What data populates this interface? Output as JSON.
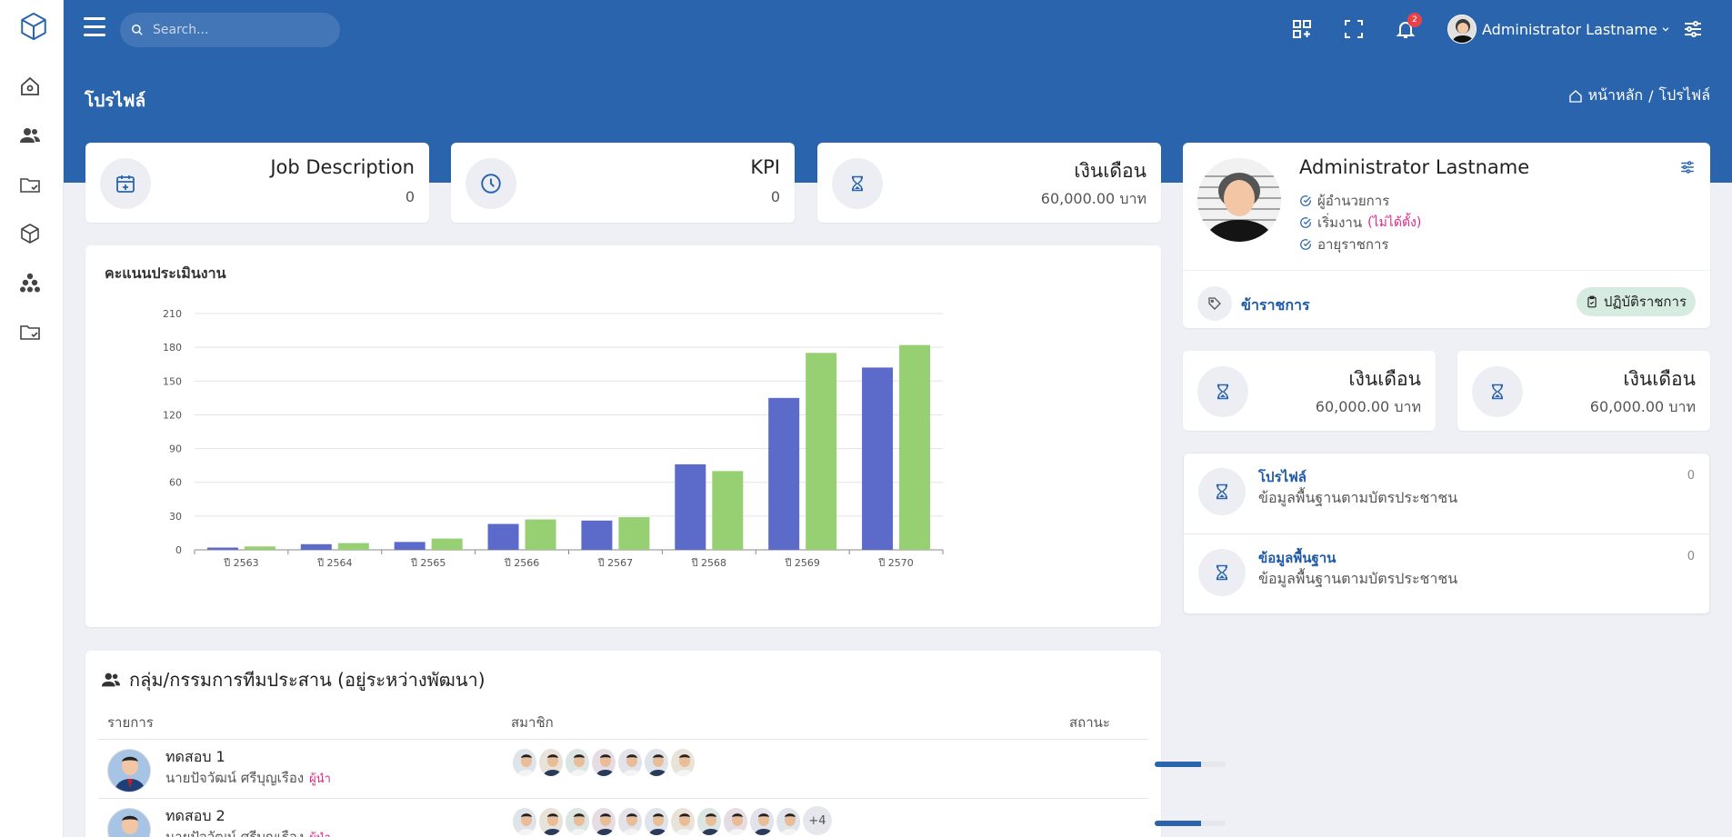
{
  "search": {
    "placeholder": "Search..."
  },
  "header": {
    "user_name": "Administrator Lastname",
    "notification_count": "2"
  },
  "page": {
    "title": "โปรไฟล์"
  },
  "breadcrumb": {
    "home": "หน้าหลัก",
    "separator": "/",
    "current": "โปรไฟล์"
  },
  "stats": [
    {
      "title": "Job Description",
      "value": "0",
      "icon": "calendar-plus-icon"
    },
    {
      "title": "KPI",
      "value": "0",
      "icon": "clock-icon"
    },
    {
      "title": "เงินเดือน",
      "value": "60,000.00 บาท",
      "icon": "hourglass-icon"
    }
  ],
  "chart_card": {
    "title": "คะแนนประเมินงาน"
  },
  "chart_data": {
    "type": "bar",
    "categories": [
      "ปี 2563",
      "ปี 2564",
      "ปี 2565",
      "ปี 2566",
      "ปี 2567",
      "ปี 2568",
      "ปี 2569",
      "ปี 2570"
    ],
    "series": [
      {
        "values": [
          2,
          5,
          7,
          23,
          26,
          76,
          135,
          162
        ],
        "color": "#5c6bc9"
      },
      {
        "values": [
          3,
          6,
          10,
          27,
          29,
          70,
          175,
          182
        ],
        "color": "#97d073"
      }
    ],
    "yticks": [
      "0",
      "30",
      "60",
      "90",
      "120",
      "150",
      "180",
      "210"
    ],
    "ylim": [
      0,
      210
    ],
    "grid": true,
    "legend": "none"
  },
  "profile": {
    "name": "Administrator Lastname",
    "position": "ผู้อำนวยการ",
    "start_label": "เริ่มงาน",
    "start_value": "(ไม่ได้ตั้ง)",
    "service": "อายุราชการ",
    "category": "ข้าราชการ",
    "status_pill": "ปฏิบัติราชการ"
  },
  "salary_cards": [
    {
      "title": "เงินเดือน",
      "value": "60,000.00 บาท"
    },
    {
      "title": "เงินเดือน",
      "value": "60,000.00 บาท"
    }
  ],
  "info_list": [
    {
      "title": "โปรไฟล์",
      "subtitle": "ข้อมูลพื้นฐานตามบัตรประชาชน",
      "count": "0"
    },
    {
      "title": "ข้อมูลพื้นฐาน",
      "subtitle": "ข้อมูลพื้นฐานตามบัตรประชาชน",
      "count": "0"
    }
  ],
  "team": {
    "title": "กลุ่ม/กรรมการทีมประสาน (อยู่ระหว่างพัฒนา)",
    "columns": {
      "item": "รายการ",
      "members": "สมาชิก",
      "status": "สถานะ"
    },
    "rows": [
      {
        "name": "ทดสอบ 1",
        "person": "นายปัจวัฒน์ ศรีบุญเรือง",
        "role": "ผู้นำ",
        "member_count": 7,
        "more": "",
        "progress": 0.65
      },
      {
        "name": "ทดสอบ 2",
        "person": "นายปัจวัฒน์ ศรีบุญเรือง",
        "role": "ผู้นำ",
        "member_count": 11,
        "more": "+4",
        "progress": 0.65
      }
    ]
  }
}
